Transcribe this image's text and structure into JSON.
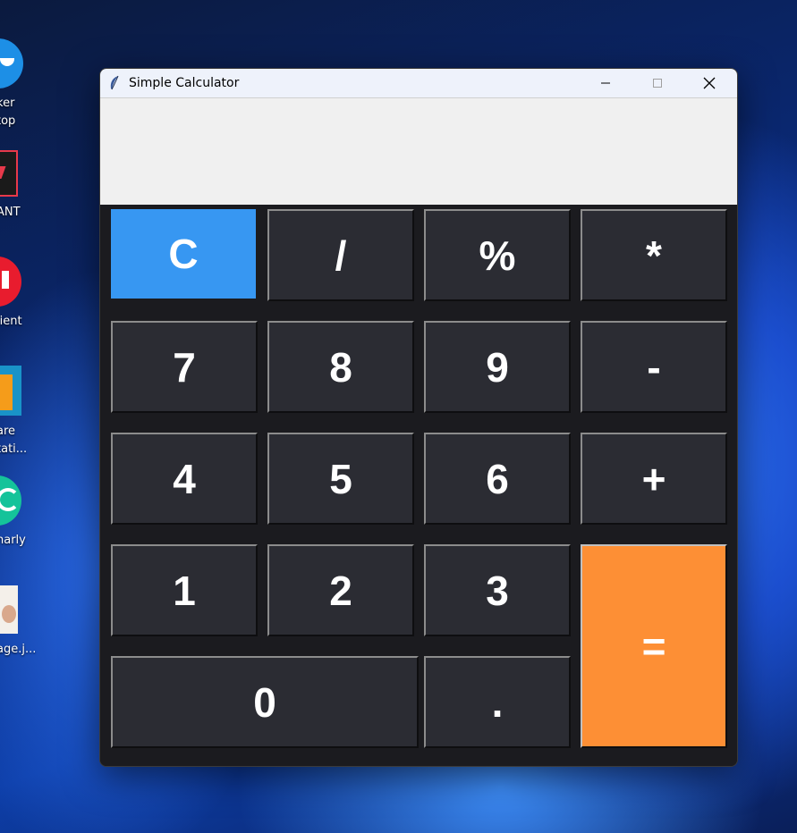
{
  "desktop": {
    "icons": [
      {
        "label": "ker",
        "label2": "top"
      },
      {
        "label": "ANT"
      },
      {
        "label": "lient"
      },
      {
        "label": "are",
        "label2": "tati..."
      },
      {
        "label": "narly"
      },
      {
        "label": "age.j..."
      }
    ]
  },
  "window": {
    "title": "Simple Calculator",
    "display_value": "",
    "controls": {
      "minimize": "minimize-icon",
      "maximize": "maximize-icon",
      "close": "close-icon"
    }
  },
  "keys": {
    "clear": "C",
    "divide": "/",
    "percent": "%",
    "multiply": "*",
    "seven": "7",
    "eight": "8",
    "nine": "9",
    "minus": "-",
    "four": "4",
    "five": "5",
    "six": "6",
    "plus": "+",
    "one": "1",
    "two": "2",
    "three": "3",
    "equals": "=",
    "zero": "0",
    "decimal": "."
  },
  "colors": {
    "clear_key": "#3797f2",
    "equals_key": "#fd8f35",
    "key_bg": "#2b2c33",
    "display_bg": "#f0f0f0"
  }
}
